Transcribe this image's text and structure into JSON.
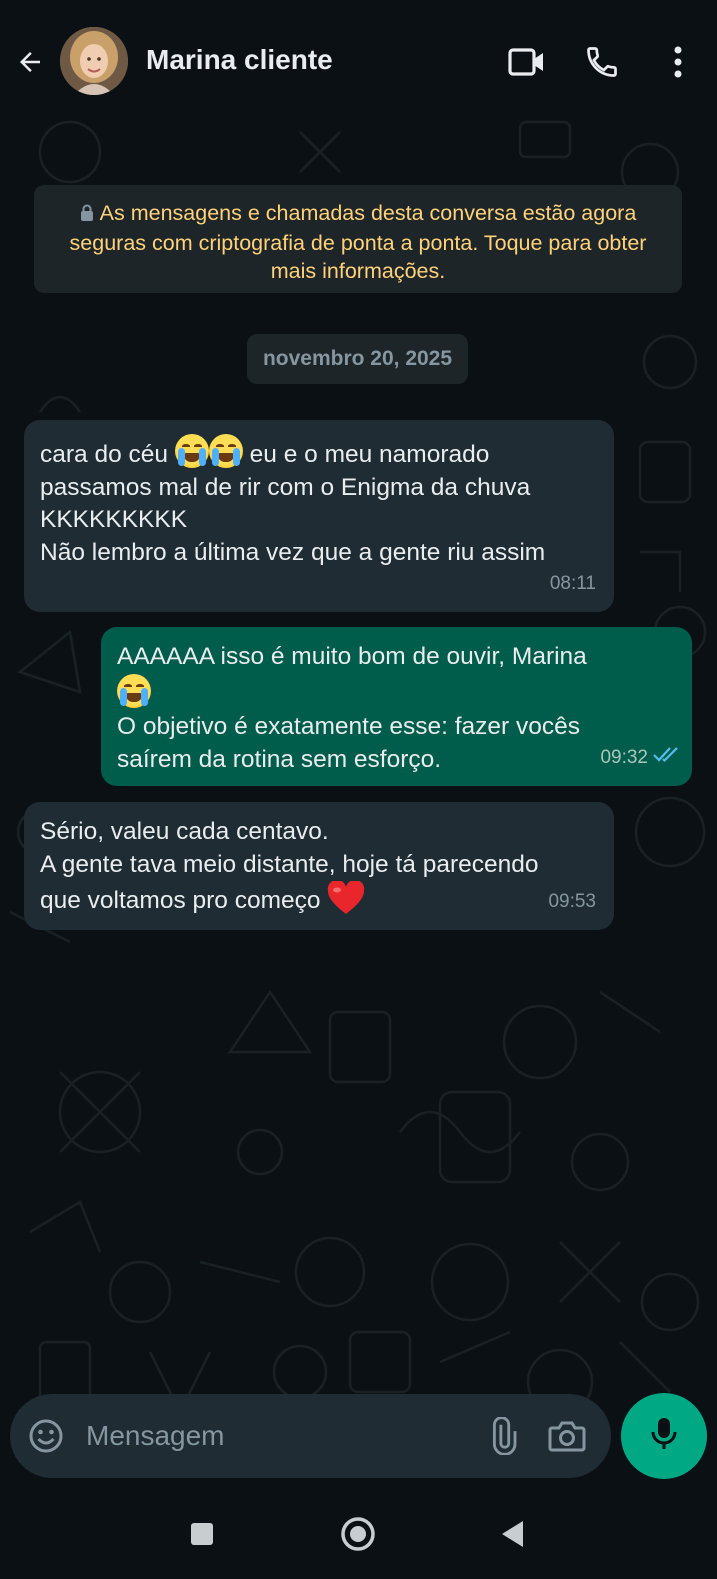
{
  "header": {
    "contact_name": "Marina cliente",
    "icons": [
      "back-arrow-icon",
      "video-call-icon",
      "phone-call-icon",
      "more-options-icon"
    ]
  },
  "encryption_notice": {
    "text": "As mensagens e chamadas desta conversa estão agora seguras com criptografia de ponta a ponta. Toque para obter mais informações.",
    "icon": "lock-icon"
  },
  "date_chip": "novembro 20, 2025",
  "messages": [
    {
      "direction": "in",
      "line1_before_emoji": "cara do céu",
      "line1_after_emoji": "eu e o meu namorado",
      "emoji": "loudly-crying-face x2",
      "line2": "passamos mal de rir com o Enigma da chuva",
      "line3": "KKKKKKKKK",
      "line4": "Não lembro a última vez que a gente riu assim",
      "time": "08:11"
    },
    {
      "direction": "out",
      "line1": "AAAAAA isso é muito bom de ouvir, Marina",
      "emoji": "face-with-tears-of-joy",
      "line3": "O objetivo é exatamente esse: fazer vocês",
      "line4": "saírem da rotina sem esforço.",
      "time": "09:32",
      "status": "read"
    },
    {
      "direction": "in",
      "line1": "Sério, valeu cada centavo.",
      "line2": "A gente tava meio distante, hoje tá parecendo",
      "line3": "que voltamos pro começo",
      "emoji": "red-heart",
      "time": "09:53"
    }
  ],
  "composer": {
    "placeholder": "Mensagem",
    "icons": [
      "emoji-icon",
      "attach-icon",
      "camera-icon",
      "mic-icon"
    ]
  },
  "colors": {
    "background": "#0b1014",
    "incoming_bubble": "#1f2c33",
    "outgoing_bubble": "#005c4b",
    "notice_text": "#ffd279",
    "accent": "#00a884",
    "read_ticks": "#53bdeb"
  }
}
